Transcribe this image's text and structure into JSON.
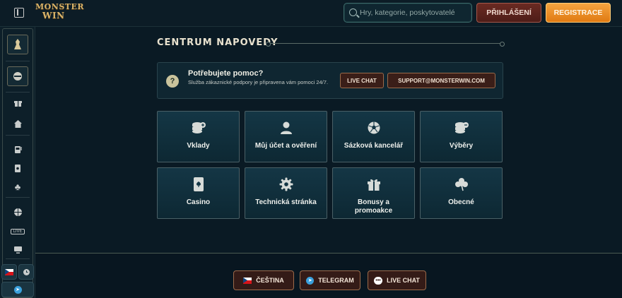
{
  "header": {
    "logo_line1": "MONSTER",
    "logo_line2": "WIN",
    "search_placeholder": "Hry, kategorie, poskytovatelé",
    "login_label": "PŘIHLÁŠENÍ",
    "register_label": "REGISTRACE"
  },
  "page": {
    "title": "CENTRUM NAPOVEDY"
  },
  "help": {
    "heading": "Potřebujete pomoc?",
    "description": "Služba zákaznické podpory je připravena vám pomoci 24/7.",
    "live_chat_label": "LIVE CHAT",
    "email_label": "SUPPORT@MONSTERWIN.COM"
  },
  "categories": [
    {
      "label": "Vklady",
      "icon": "coins-plus-icon"
    },
    {
      "label": "Můj účet a ověření",
      "icon": "user-icon"
    },
    {
      "label": "Sázková kancelář",
      "icon": "football-icon"
    },
    {
      "label": "Výběry",
      "icon": "coins-minus-icon"
    },
    {
      "label": "Casino",
      "icon": "playing-card-icon"
    },
    {
      "label": "Technická stránka",
      "icon": "gear-icon"
    },
    {
      "label": "Bonusy a promoakce",
      "icon": "gift-icon"
    },
    {
      "label": "Obecné",
      "icon": "clover-icon"
    }
  ],
  "footer": {
    "language_label": "ČEŠTINA",
    "telegram_label": "TELEGRAM",
    "live_chat_label": "LIVE CHAT"
  },
  "colors": {
    "background": "#0a1a24",
    "accent_orange": "#e07a12",
    "accent_red": "#6a2a22",
    "gold": "#d8b36a"
  }
}
